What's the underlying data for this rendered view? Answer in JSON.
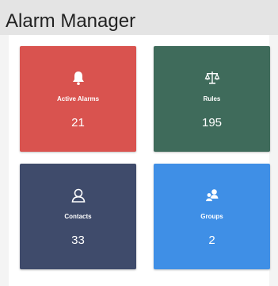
{
  "title": "Alarm Manager",
  "tiles": [
    {
      "label": "Active Alarms",
      "count": "21",
      "icon": "bell-icon",
      "color": "#d9534f"
    },
    {
      "label": "Rules",
      "count": "195",
      "icon": "balance-scale-icon",
      "color": "#3f6b5b"
    },
    {
      "label": "Contacts",
      "count": "33",
      "icon": "user-outline-icon",
      "color": "#3f4b6b"
    },
    {
      "label": "Groups",
      "count": "2",
      "icon": "users-icon",
      "color": "#3f8fe6"
    }
  ]
}
